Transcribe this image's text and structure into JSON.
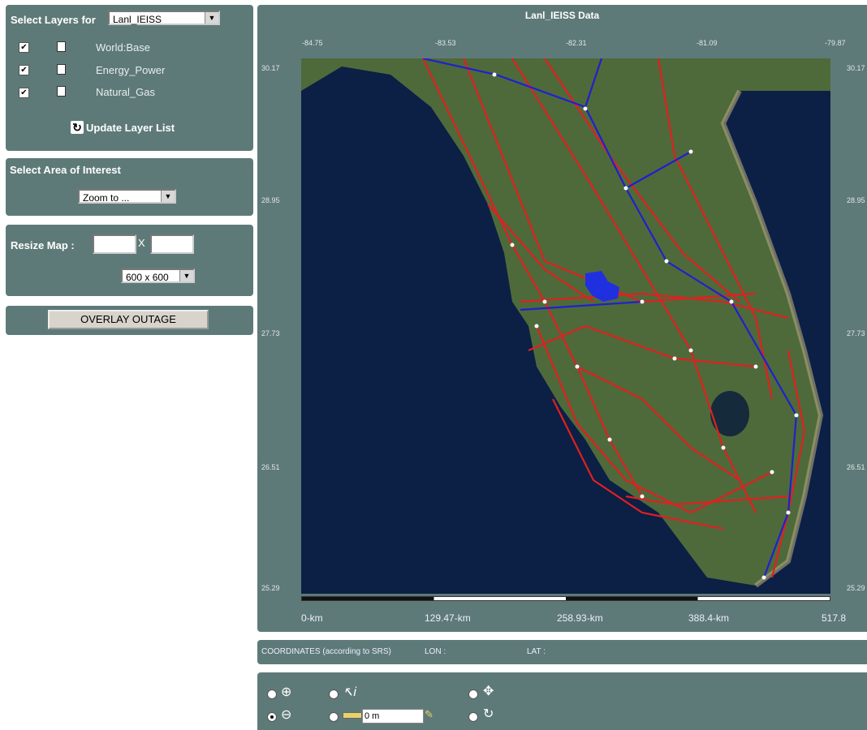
{
  "layers_panel": {
    "title": "Select Layers for",
    "selected_dataset": "Lanl_IEISS",
    "layers": [
      {
        "name": "World:Base",
        "checked": true
      },
      {
        "name": "Energy_Power",
        "checked": true
      },
      {
        "name": "Natural_Gas",
        "checked": true
      }
    ],
    "update_label": "Update Layer List"
  },
  "area_panel": {
    "title": "Select Area of Interest",
    "zoom_value": "Zoom to ..."
  },
  "resize_panel": {
    "title": "Resize Map :",
    "x_label": "X",
    "width_value": "",
    "height_value": "",
    "size_value": "600 x 600"
  },
  "overlay_button": {
    "label": "OVERLAY OUTAGE"
  },
  "map": {
    "title": "Lanl_IEISS Data",
    "lon_ticks": [
      "-84.75",
      "-83.53",
      "-82.31",
      "-81.09",
      "-79.87"
    ],
    "lat_ticks": [
      "30.17",
      "28.95",
      "27.73",
      "26.51",
      "25.29"
    ],
    "scale_labels": [
      "0-km",
      "129.47-km",
      "258.93-km",
      "388.4-km",
      "517.8"
    ],
    "colors": {
      "land": "#4e6a3a",
      "water": "#0c1f45",
      "power_lines": "#e02020",
      "gas_lines": "#2020d0"
    }
  },
  "coordinates": {
    "label": "COORDINATES (according to SRS)",
    "lon_label": "LON :",
    "lat_label": "LAT :"
  },
  "tools": {
    "icons": [
      "zoom-in-icon",
      "zoom-out-icon",
      "info-icon",
      "measure-icon",
      "pan-icon",
      "refresh-icon"
    ],
    "measure_value": "0 m"
  }
}
